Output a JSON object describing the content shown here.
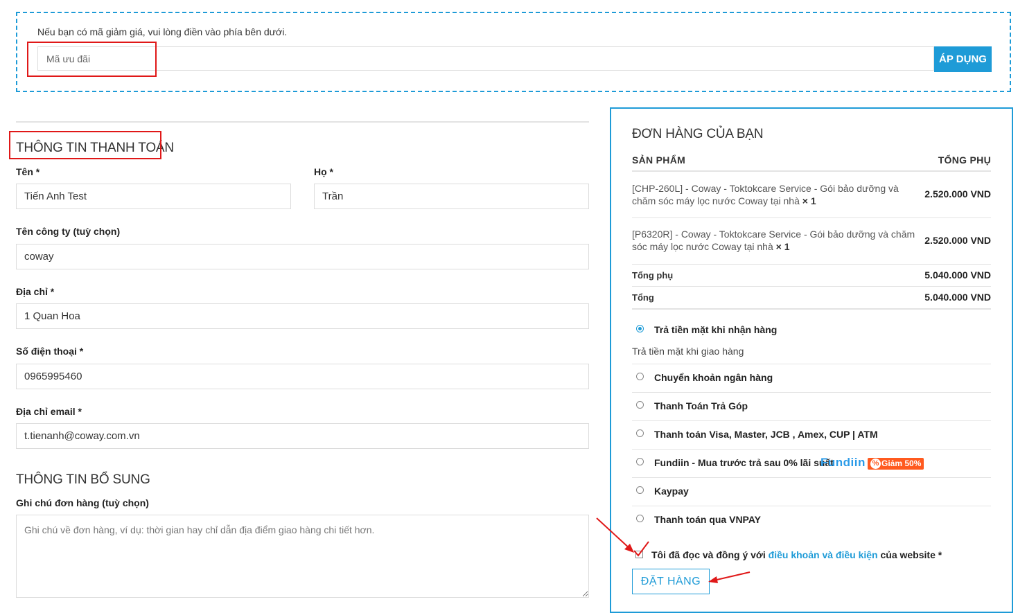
{
  "coupon": {
    "prompt": "Nếu bạn có mã giảm giá, vui lòng điền vào phía bên dưới.",
    "placeholder": "Mã ưu đãi",
    "apply_label": "ÁP DỤNG"
  },
  "billing": {
    "title": "THÔNG TIN THANH TOÁN",
    "first_name_label": "Tên *",
    "first_name_value": "Tiến Anh Test",
    "last_name_label": "Họ *",
    "last_name_value": "Trần",
    "company_label": "Tên công ty (tuỳ chọn)",
    "company_value": "coway",
    "address_label": "Địa chỉ *",
    "address_value": "1 Quan Hoa",
    "phone_label": "Số điện thoại *",
    "phone_value": "0965995460",
    "email_label": "Địa chỉ email *",
    "email_value": "t.tienanh@coway.com.vn"
  },
  "additional": {
    "title": "THÔNG TIN BỔ SUNG",
    "notes_label": "Ghi chú đơn hàng (tuỳ chọn)",
    "notes_placeholder": "Ghi chú về đơn hàng, ví dụ: thời gian hay chỉ dẫn địa điểm giao hàng chi tiết hơn."
  },
  "order": {
    "title": "ĐƠN HÀNG CỦA BẠN",
    "col_product": "SẢN PHẨM",
    "col_subtotal": "TỔNG PHỤ",
    "items": [
      {
        "name": "[CHP-260L] - Coway - Toktokcare Service - Gói bảo dưỡng và chăm sóc máy lọc nước Coway tại nhà",
        "qty": "× 1",
        "price": "2.520.000 VND"
      },
      {
        "name": "[P6320R] - Coway - Toktokcare Service - Gói bảo dưỡng và chăm sóc máy lọc nước Coway tại nhà",
        "qty": "× 1",
        "price": "2.520.000 VND"
      }
    ],
    "subtotal_label": "Tổng phụ",
    "subtotal_value": "5.040.000 VND",
    "total_label": "Tổng",
    "total_value": "5.040.000 VND"
  },
  "payment": {
    "methods": [
      {
        "label": "Trả tiền mặt khi nhận hàng",
        "selected": true,
        "description": "Trả tiền mặt khi giao hàng"
      },
      {
        "label": "Chuyển khoản ngân hàng",
        "selected": false
      },
      {
        "label": "Thanh Toán Trả Góp",
        "selected": false
      },
      {
        "label": "Thanh toán Visa, Master, JCB , Amex, CUP | ATM",
        "selected": false
      },
      {
        "label": "Fundiin - Mua trước trả sau 0% lãi suất",
        "selected": false
      },
      {
        "label": "Kaypay",
        "selected": false
      },
      {
        "label": "Thanh toán qua VNPAY",
        "selected": false
      }
    ],
    "fundiin_logo": "Fundiin",
    "fundiin_badge_pct": "%",
    "fundiin_badge": "Giảm 50%"
  },
  "terms": {
    "prefix": "Tôi đã đọc và đồng ý với ",
    "link": "điều khoản và điều kiện",
    "suffix": " của website *",
    "checked": true
  },
  "place_order_label": "ĐẶT HÀNG",
  "colors": {
    "accent": "#1e9bd7",
    "highlight": "#e01818",
    "discount_badge": "#ff5a1f"
  }
}
